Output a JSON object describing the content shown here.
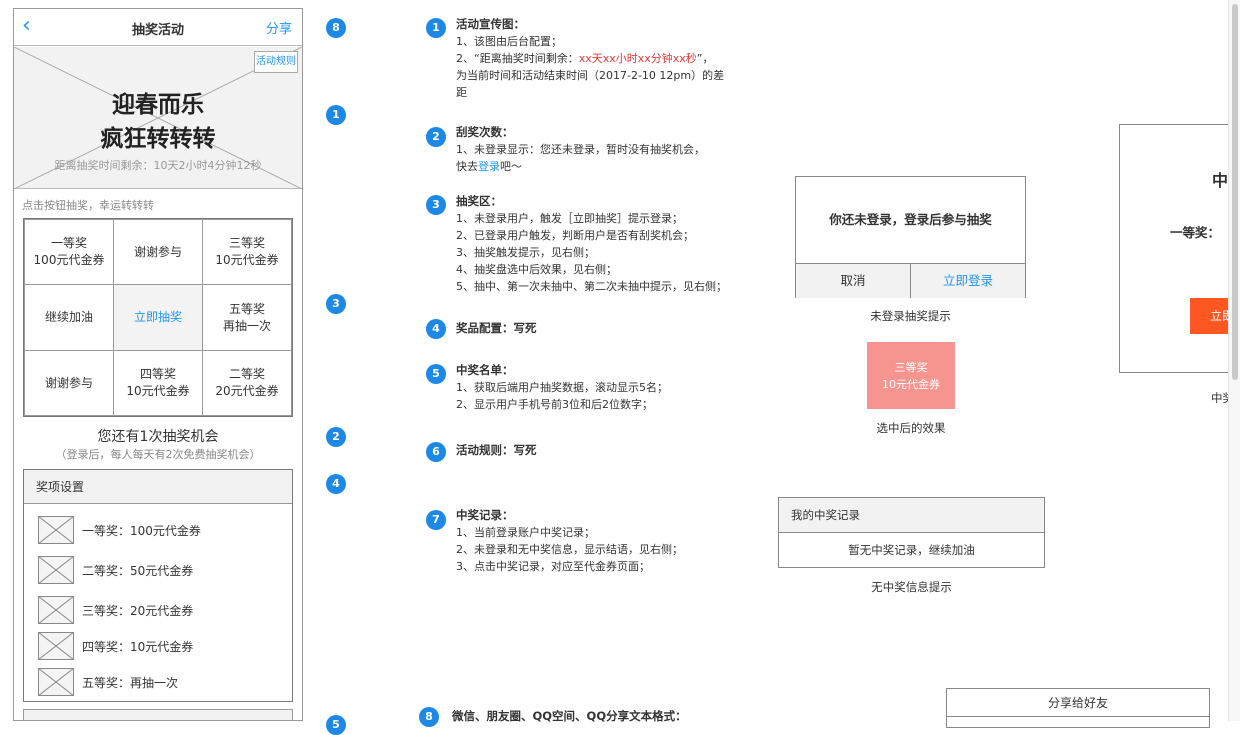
{
  "phone": {
    "nav": {
      "back_icon": "chevron-left",
      "title": "抽奖活动",
      "share": "分享"
    },
    "banner": {
      "title_line1": "迎春而乐",
      "title_line2": "疯狂转转转",
      "countdown": "距离抽奖时间剩余：10天2小时4分钟12秒",
      "rules": "活动规则"
    },
    "hint": "点击按钮抽奖，幸运转转转",
    "grid": [
      {
        "l1": "一等奖",
        "l2": "100元代金券"
      },
      {
        "l1": "谢谢参与",
        "l2": ""
      },
      {
        "l1": "三等奖",
        "l2": "10元代金券"
      },
      {
        "l1": "继续加油",
        "l2": ""
      },
      {
        "l1": "立即抽奖",
        "l2": ""
      },
      {
        "l1": "五等奖",
        "l2": "再抽一次"
      },
      {
        "l1": "谢谢参与",
        "l2": ""
      },
      {
        "l1": "四等奖",
        "l2": "10元代金券"
      },
      {
        "l1": "二等奖",
        "l2": "20元代金券"
      }
    ],
    "chance": "您还有1次抽奖机会",
    "chance_sub": "（登录后，每人每天有2次免费抽奖机会）",
    "prizes": {
      "title": "奖项设置",
      "items": [
        {
          "label": "一等奖：100元代金券"
        },
        {
          "label": "二等奖：50元代金券"
        },
        {
          "label": "三等奖：20元代金券"
        },
        {
          "label": "四等奖：10元代金券"
        },
        {
          "label": "五等奖：再抽一次"
        }
      ]
    }
  },
  "markers": {
    "left": [
      "8",
      "1",
      "3",
      "2",
      "4",
      "5"
    ],
    "ann": [
      "1",
      "2",
      "3",
      "4",
      "5",
      "6",
      "7",
      "8"
    ]
  },
  "annotations": {
    "a1": {
      "title": "活动宣传图：",
      "l1": "1、该图由后台配置；",
      "l2_pre": "2、“距离抽奖时间剩余：",
      "l2_red": "xx天xx小时xx分钟xx秒",
      "l2_post": "”，",
      "l3": "为当前时间和活动结束时间（2017-2-10 12pm）的差",
      "l4": "距"
    },
    "a2": {
      "title": "刮奖次数：",
      "l1": "1、未登录显示：您还未登录，暂时没有抽奖机会，",
      "l2_pre": "快去",
      "l2_link": "登录",
      "l2_post": "吧～"
    },
    "a3": {
      "title": "抽奖区：",
      "lines": [
        "1、未登录用户，触发［立即抽奖］提示登录；",
        "2、已登录用户触发，判断用户是否有刮奖机会；",
        "3、抽奖触发提示，见右侧；",
        "4、抽奖盘选中后效果，见右侧；",
        "5、抽中、第一次未抽中、第二次未抽中提示，见右侧；"
      ]
    },
    "a4": {
      "title": "奖品配置：写死"
    },
    "a5": {
      "title": "中奖名单：",
      "l1": "1、获取后端用户抽奖数据，滚动显示5名；",
      "l2": "2、显示用户手机号前3位和后2位数字；"
    },
    "a6": {
      "title": "活动规则：写死"
    },
    "a7": {
      "title": "中奖记录：",
      "l1": "1、当前登录账户中奖记录；",
      "l2": "2、未登录和无中奖信息，显示结语，见右侧；",
      "l3": "3、点击中奖记录，对应至代金券页面；"
    },
    "a8": {
      "title": "微信、朋友圈、QQ空间、QQ分享文本格式："
    }
  },
  "dialogs": {
    "login": {
      "message": "你还未登录，登录后参与抽奖",
      "cancel": "取消",
      "login": "立即登录",
      "caption": "未登录抽奖提示"
    },
    "selected": {
      "l1": "三等奖",
      "l2": "10元代金券",
      "caption": "选中后的效果"
    },
    "record": {
      "title": "我的中奖记录",
      "message": "暂无中奖记录，继续加油",
      "caption": "无中奖信息提示"
    },
    "win": {
      "title": "中",
      "prize": "一等奖：",
      "button": "立即",
      "caption": "中奖"
    },
    "share": {
      "title": "分享给好友"
    }
  },
  "colors": {
    "accent": "#2196f3",
    "marker": "#1e88e5",
    "red": "#e53935",
    "selected": "#f6948f",
    "orange": "#ff5722"
  }
}
